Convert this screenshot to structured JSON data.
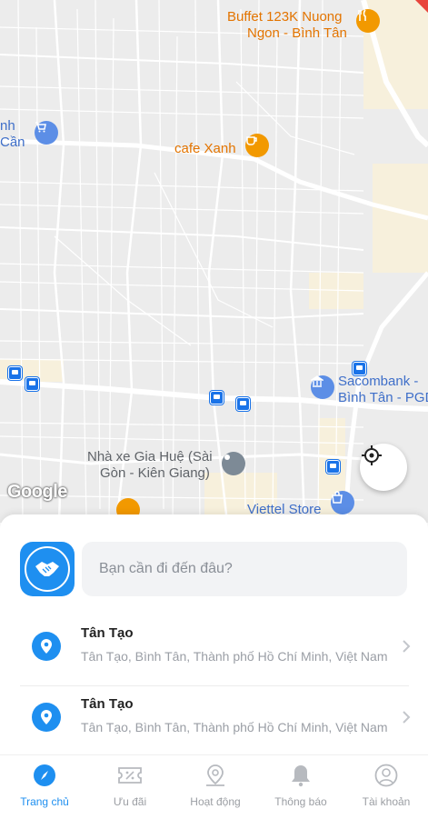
{
  "map": {
    "pois": [
      {
        "name": "Buffet 123K Nuong",
        "line2": "Ngon - Bình Tân",
        "kind": "restaurant"
      },
      {
        "name": "cafe Xanh",
        "kind": "cafe"
      },
      {
        "name": "Sacombank -",
        "line2": "Bình Tân - PGD",
        "kind": "bank"
      },
      {
        "name": "Nhà xe Gia Huệ (Sài",
        "line2": "Gòn - Kiên Giang)",
        "kind": "place"
      },
      {
        "name": "Viettel Store",
        "kind": "shop"
      },
      {
        "name": "nh",
        "line2": "Cần",
        "kind": "shop"
      }
    ],
    "attribution": "Google",
    "locate_icon": "crosshair-icon"
  },
  "sheet": {
    "search_placeholder": "Bạn cần đi đến đâu?",
    "brand_icon": "handshake-icon",
    "places": [
      {
        "title": "Tân Tạo",
        "subtitle": "Tân Tạo, Bình Tân, Thành phố Hồ Chí Minh, Việt Nam"
      },
      {
        "title": "Tân Tạo",
        "subtitle": "Tân Tạo, Bình Tân, Thành phố Hồ Chí Minh, Việt Nam"
      }
    ]
  },
  "tabs": [
    {
      "label": "Trang chủ",
      "icon": "compass-icon",
      "active": true
    },
    {
      "label": "Ưu đãi",
      "icon": "coupon-icon",
      "active": false
    },
    {
      "label": "Hoạt động",
      "icon": "location-history-icon",
      "active": false
    },
    {
      "label": "Thông báo",
      "icon": "bell-icon",
      "active": false
    },
    {
      "label": "Tài khoản",
      "icon": "user-icon",
      "active": false
    }
  ],
  "colors": {
    "accent": "#1E8FF0",
    "poi_orange": "#E37400",
    "poi_blue": "#3F6FC9"
  }
}
